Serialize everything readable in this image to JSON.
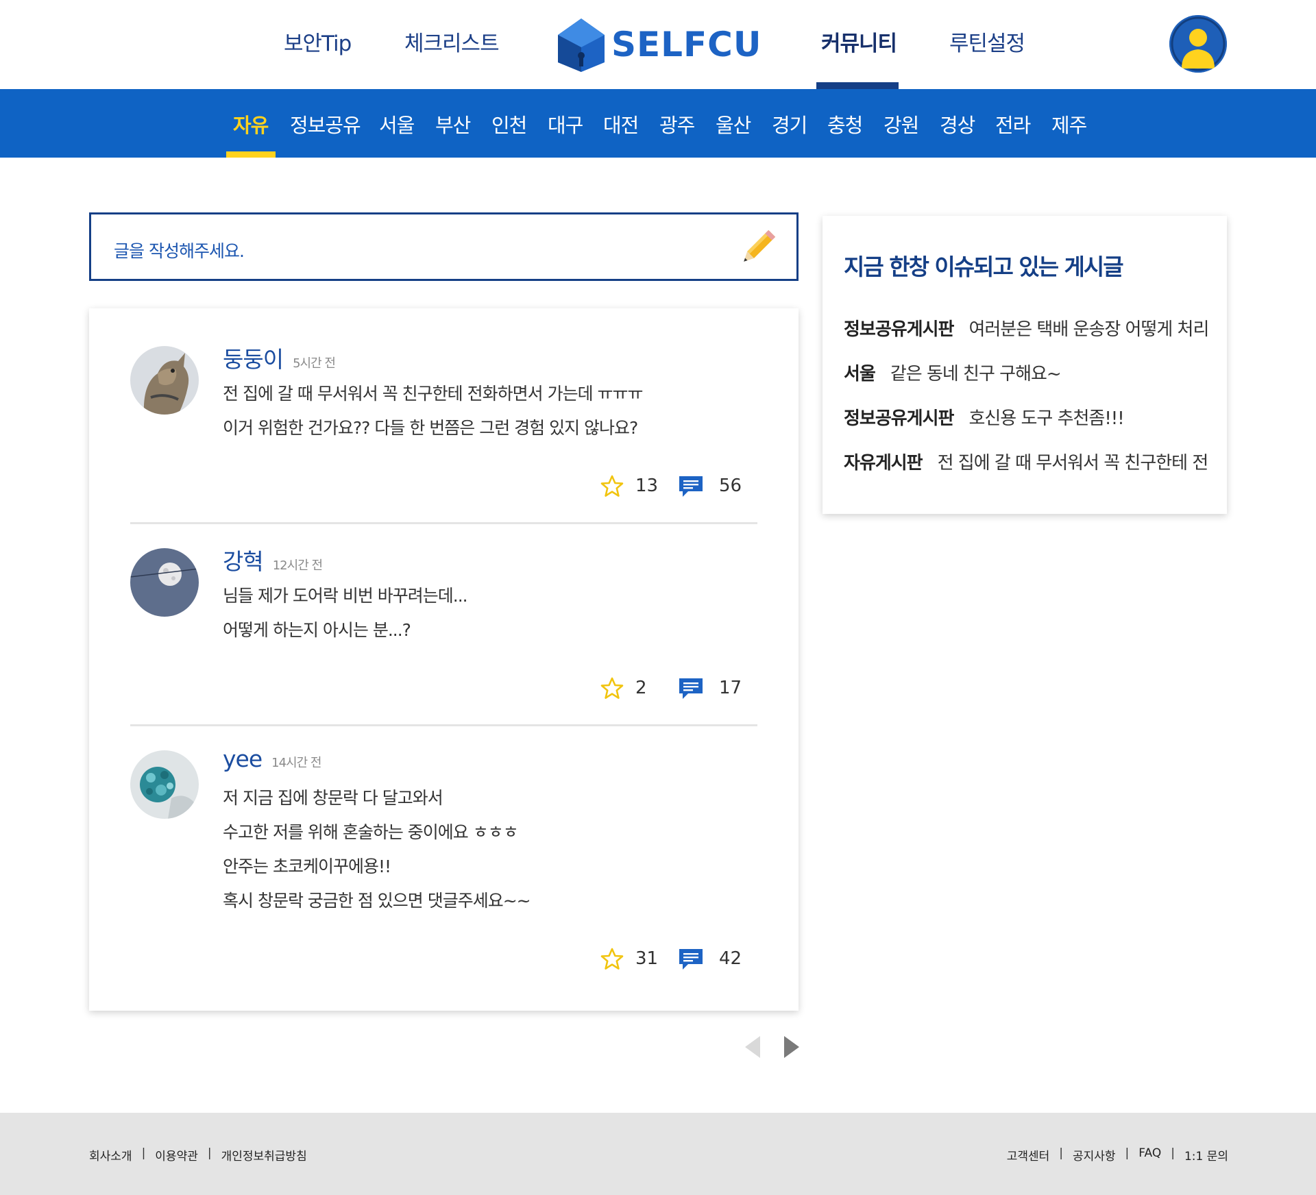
{
  "brand": {
    "name": "SELFCU",
    "primary_color": "#0f63c4",
    "dark_color": "#153f86",
    "accent_color": "#ffd21e"
  },
  "top_nav": {
    "items": [
      {
        "label": "보안Tip"
      },
      {
        "label": "체크리스트"
      },
      {
        "label": "커뮤니티",
        "active": true
      },
      {
        "label": "루틴설정"
      }
    ],
    "profile_icon": "user-avatar-icon"
  },
  "categories": {
    "items": [
      "자유",
      "정보공유",
      "서울",
      "부산",
      "인천",
      "대구",
      "대전",
      "광주",
      "울산",
      "경기",
      "충청",
      "강원",
      "경상",
      "전라",
      "제주"
    ],
    "active": "자유"
  },
  "write_box": {
    "placeholder": "글을 작성해주세요.",
    "icon": "pencil-icon"
  },
  "posts": [
    {
      "author": "둥둥이",
      "time": "5시간 전",
      "lines": [
        "전 집에 갈 때 무서워서 꼭 친구한테 전화하면서 가는데 ㅠㅠㅠ",
        "이거 위험한 건가요?? 다들 한 번쯤은 그런 경험 있지 않나요?"
      ],
      "stars": "13",
      "comments": "56",
      "avatar_icon": "cat-photo-avatar"
    },
    {
      "author": "강혁",
      "time": "12시간 전",
      "lines": [
        "님들 제가 도어락 비번 바꾸려는데...",
        "어떻게 하는지 아시는 분...?"
      ],
      "stars": "2",
      "comments": "17",
      "avatar_icon": "moon-photo-avatar"
    },
    {
      "author": "yee",
      "time": "14시간 전",
      "lines": [
        "저 지금 집에 창문락 다 달고와서",
        "수고한 저를 위해 혼술하는 중이에요 ㅎㅎㅎ",
        "안주는 초코케이꾸에용!!",
        "혹시 창문락 궁금한 점 있으면 댓글주세요~~"
      ],
      "stars": "31",
      "comments": "42",
      "avatar_icon": "flower-photo-avatar"
    }
  ],
  "pager": {
    "prev_icon": "triangle-left-icon",
    "next_icon": "triangle-right-icon"
  },
  "trending": {
    "title": "지금 한창 이슈되고 있는 게시글",
    "items": [
      {
        "board": "정보공유게시판",
        "text": "여러분은 택배 운송장 어떻게 처리"
      },
      {
        "board": "서울",
        "text": "같은 동네 친구 구해요~"
      },
      {
        "board": "정보공유게시판",
        "text": "호신용 도구 추천좀!!!"
      },
      {
        "board": "자유게시판",
        "text": "전 집에 갈 때 무서워서 꼭 친구한테 전"
      }
    ]
  },
  "footer": {
    "left": [
      "회사소개",
      "이용약관",
      "개인정보취급방침"
    ],
    "right": [
      "고객센터",
      "공지사항",
      "FAQ",
      "1:1 문의"
    ]
  }
}
